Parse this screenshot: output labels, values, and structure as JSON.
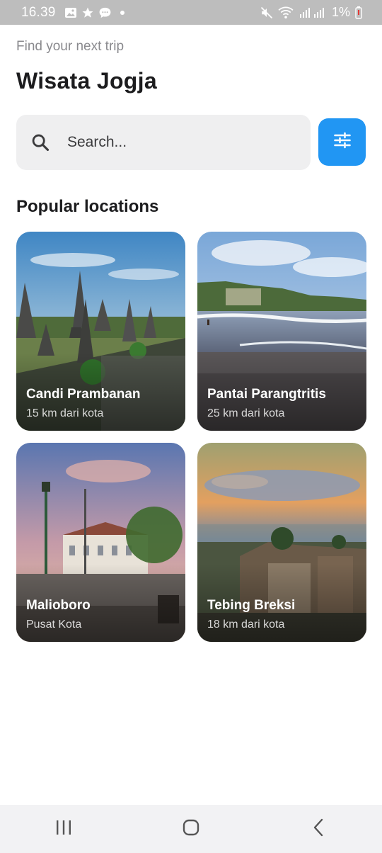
{
  "status_bar": {
    "time": "16.39",
    "battery": "1%",
    "icons": [
      "gallery-icon",
      "star-icon",
      "chat-icon",
      "mute-icon",
      "wifi-icon",
      "signal-icon",
      "battery-icon"
    ]
  },
  "header": {
    "subtitle": "Find your next trip",
    "title": "Wisata Jogja"
  },
  "search": {
    "placeholder": "Search...",
    "value": "",
    "icon": "search-icon"
  },
  "filter_button": {
    "icon": "tune-icon",
    "color": "#2196f3"
  },
  "section": {
    "title": "Popular locations"
  },
  "locations": [
    {
      "name": "Candi Prambanan",
      "subtitle": "15 km dari kota"
    },
    {
      "name": "Pantai Parangtritis",
      "subtitle": "25 km dari kota"
    },
    {
      "name": "Malioboro",
      "subtitle": "Pusat Kota"
    },
    {
      "name": "Tebing Breksi",
      "subtitle": "18 km dari kota"
    }
  ],
  "nav_bar": {
    "buttons": [
      "recent-apps-icon",
      "home-icon",
      "back-icon"
    ]
  }
}
